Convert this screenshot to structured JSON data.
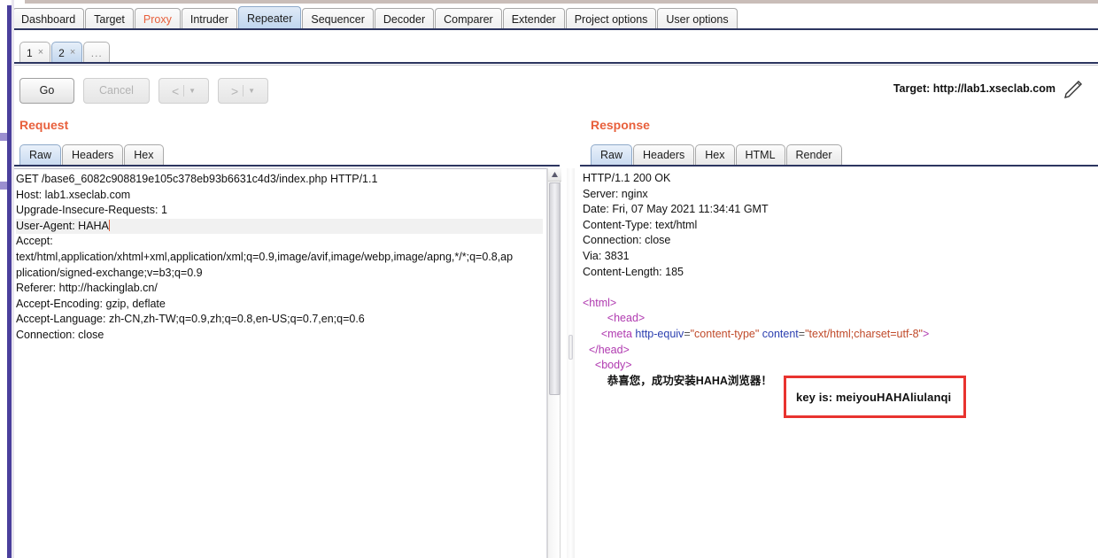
{
  "main_tabs": [
    {
      "label": "Dashboard",
      "state": "normal"
    },
    {
      "label": "Target",
      "state": "normal"
    },
    {
      "label": "Proxy",
      "state": "accent"
    },
    {
      "label": "Intruder",
      "state": "normal"
    },
    {
      "label": "Repeater",
      "state": "active"
    },
    {
      "label": "Sequencer",
      "state": "normal"
    },
    {
      "label": "Decoder",
      "state": "normal"
    },
    {
      "label": "Comparer",
      "state": "normal"
    },
    {
      "label": "Extender",
      "state": "normal"
    },
    {
      "label": "Project options",
      "state": "normal"
    },
    {
      "label": "User options",
      "state": "normal"
    }
  ],
  "sub_tabs": [
    {
      "label": "1",
      "close": "×",
      "state": "normal"
    },
    {
      "label": "2",
      "close": "×",
      "state": "active"
    },
    {
      "label": "...",
      "close": "",
      "state": "more"
    }
  ],
  "toolbar": {
    "go_label": "Go",
    "cancel_label": "Cancel",
    "prev_label": "<",
    "next_label": ">",
    "prev_caret": "▼",
    "next_caret": "▼",
    "target_label": "Target: http://lab1.xseclab.com",
    "edit_icon": "pencil-icon"
  },
  "request": {
    "title": "Request",
    "tabs": [
      {
        "label": "Raw",
        "state": "active"
      },
      {
        "label": "Headers",
        "state": "normal"
      },
      {
        "label": "Hex",
        "state": "normal"
      }
    ],
    "lines": [
      {
        "text": "GET /base6_6082c908819e105c378eb93b6631c4d3/index.php HTTP/1.1",
        "highlight": false,
        "caret": false
      },
      {
        "text": "Host: lab1.xseclab.com",
        "highlight": false,
        "caret": false
      },
      {
        "text": "Upgrade-Insecure-Requests: 1",
        "highlight": false,
        "caret": false
      },
      {
        "text": "User-Agent: HAHA",
        "highlight": true,
        "caret": true
      },
      {
        "text": "Accept:",
        "highlight": false,
        "caret": false
      },
      {
        "text": "text/html,application/xhtml+xml,application/xml;q=0.9,image/avif,image/webp,image/apng,*/*;q=0.8,ap",
        "highlight": false,
        "caret": false
      },
      {
        "text": "plication/signed-exchange;v=b3;q=0.9",
        "highlight": false,
        "caret": false
      },
      {
        "text": "Referer: http://hackinglab.cn/",
        "highlight": false,
        "caret": false
      },
      {
        "text": "Accept-Encoding: gzip, deflate",
        "highlight": false,
        "caret": false
      },
      {
        "text": "Accept-Language: zh-CN,zh-TW;q=0.9,zh;q=0.8,en-US;q=0.7,en;q=0.6",
        "highlight": false,
        "caret": false
      },
      {
        "text": "Connection: close",
        "highlight": false,
        "caret": false
      }
    ],
    "scrollbar": {
      "up_arrow": "▲"
    }
  },
  "response": {
    "title": "Response",
    "tabs": [
      {
        "label": "Raw",
        "state": "active"
      },
      {
        "label": "Headers",
        "state": "normal"
      },
      {
        "label": "Hex",
        "state": "normal"
      },
      {
        "label": "HTML",
        "state": "normal"
      },
      {
        "label": "Render",
        "state": "normal"
      }
    ],
    "header_lines": [
      "HTTP/1.1 200 OK",
      "Server: nginx",
      "Date: Fri, 07 May 2021 11:34:41 GMT",
      "Content-Type: text/html",
      "Connection: close",
      "Via: 3831",
      "Content-Length: 185"
    ],
    "body_lines": [
      {
        "indent": 0,
        "tokens": [
          {
            "t": "tag",
            "v": "<html>"
          }
        ]
      },
      {
        "indent": 4,
        "tokens": [
          {
            "t": "tag",
            "v": "<head>"
          }
        ]
      },
      {
        "indent": 3,
        "tokens": [
          {
            "t": "tag",
            "v": "<meta "
          },
          {
            "t": "attr",
            "v": "http-equiv"
          },
          {
            "t": "punct",
            "v": "="
          },
          {
            "t": "val",
            "v": "\"content-type\""
          },
          {
            "t": "plain",
            "v": " "
          },
          {
            "t": "attr",
            "v": "content"
          },
          {
            "t": "punct",
            "v": "="
          },
          {
            "t": "val",
            "v": "\"text/html;charset=utf-8\""
          },
          {
            "t": "tag",
            "v": ">"
          }
        ]
      },
      {
        "indent": 1,
        "tokens": [
          {
            "t": "tag",
            "v": "</head>"
          }
        ]
      },
      {
        "indent": 2,
        "tokens": [
          {
            "t": "tag",
            "v": "<body>"
          }
        ]
      },
      {
        "indent": 4,
        "tokens": [
          {
            "t": "cjk",
            "v": "恭喜您，成功安装HAHA浏览器！"
          }
        ]
      }
    ]
  },
  "key_callout": {
    "text": "key is: meiyouHAHAliulanqi",
    "border_color": "#e8332f"
  },
  "colors": {
    "accent": "#e8603c",
    "tab_active": "#c8daf0",
    "rule": "#2c3560",
    "rail": "#4a3f9c"
  }
}
